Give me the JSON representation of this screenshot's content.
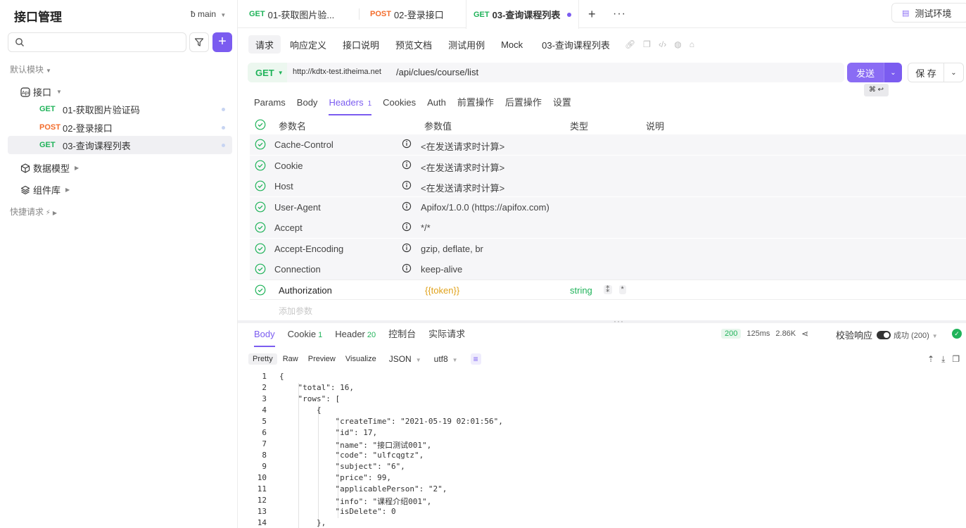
{
  "sidebar": {
    "title": "接口管理",
    "branch": "main",
    "default_group": "默认模块",
    "folder_api": "接口",
    "apis": [
      {
        "method": "GET",
        "name": "01-获取图片验证码"
      },
      {
        "method": "POST",
        "name": "02-登录接口"
      },
      {
        "method": "GET",
        "name": "03-查询课程列表"
      }
    ],
    "data_models": "数据模型",
    "components": "组件库",
    "quick_requests": "快捷请求"
  },
  "tabs": [
    {
      "method": "GET",
      "label": "01-获取图片验..."
    },
    {
      "method": "POST",
      "label": "02-登录接口"
    },
    {
      "method": "GET",
      "label": "03-查询课程列表"
    }
  ],
  "environment": "测试环境",
  "subtabs": [
    "请求",
    "响应定义",
    "接口说明",
    "预览文档",
    "测试用例",
    "Mock"
  ],
  "api_name": "03-查询课程列表",
  "request": {
    "method": "GET",
    "base_url": "http://kdtx-test.itheima.net",
    "path": "/api/clues/course/list",
    "send_label": "发送",
    "send_shortcut": "⌘ ↩",
    "save_label": "保 存"
  },
  "param_tabs": [
    {
      "label": "Params",
      "count": ""
    },
    {
      "label": "Body",
      "count": ""
    },
    {
      "label": "Headers",
      "count": "1"
    },
    {
      "label": "Cookies",
      "count": ""
    },
    {
      "label": "Auth",
      "count": ""
    },
    {
      "label": "前置操作",
      "count": ""
    },
    {
      "label": "后置操作",
      "count": ""
    },
    {
      "label": "设置",
      "count": ""
    }
  ],
  "headers_columns": {
    "name": "参数名",
    "value": "参数值",
    "type": "类型",
    "desc": "说明"
  },
  "auto_headers": [
    {
      "name": "Cache-Control",
      "value": "<在发送请求时计算>"
    },
    {
      "name": "Cookie",
      "value": "<在发送请求时计算>"
    },
    {
      "name": "Host",
      "value": "<在发送请求时计算>"
    },
    {
      "name": "User-Agent",
      "value": "Apifox/1.0.0 (https://apifox.com)"
    },
    {
      "name": "Accept",
      "value": "*/*"
    },
    {
      "name": "Accept-Encoding",
      "value": "gzip, deflate, br"
    },
    {
      "name": "Connection",
      "value": "keep-alive"
    }
  ],
  "custom_header": {
    "name": "Authorization",
    "value": "{{token}}",
    "type": "string",
    "required": "*"
  },
  "add_param": "添加参数",
  "response": {
    "tabs": [
      {
        "label": "Body",
        "count": ""
      },
      {
        "label": "Cookie",
        "count": "1"
      },
      {
        "label": "Header",
        "count": "20"
      },
      {
        "label": "控制台",
        "count": ""
      },
      {
        "label": "实际请求",
        "count": ""
      }
    ],
    "status": "200",
    "time": "125ms",
    "size": "2.86K",
    "verify_label": "校验响应",
    "verify_result": "成功 (200)",
    "formats": [
      "Pretty",
      "Raw",
      "Preview",
      "Visualize"
    ],
    "lang": "JSON",
    "encoding": "utf8",
    "code_lines": [
      "{",
      "    \"total\": 16,",
      "    \"rows\": [",
      "        {",
      "            \"createTime\": \"2021-05-19 02:01:56\",",
      "            \"id\": 17,",
      "            \"name\": \"接口测试001\",",
      "            \"code\": \"ulfcqgtz\",",
      "            \"subject\": \"6\",",
      "            \"price\": 99,",
      "            \"applicablePerson\": \"2\",",
      "            \"info\": \"课程介绍001\",",
      "            \"isDelete\": 0",
      "        },"
    ]
  },
  "colors": {
    "accent": "#7b5cf0",
    "get": "#20b35a",
    "post": "#f36c2b"
  }
}
